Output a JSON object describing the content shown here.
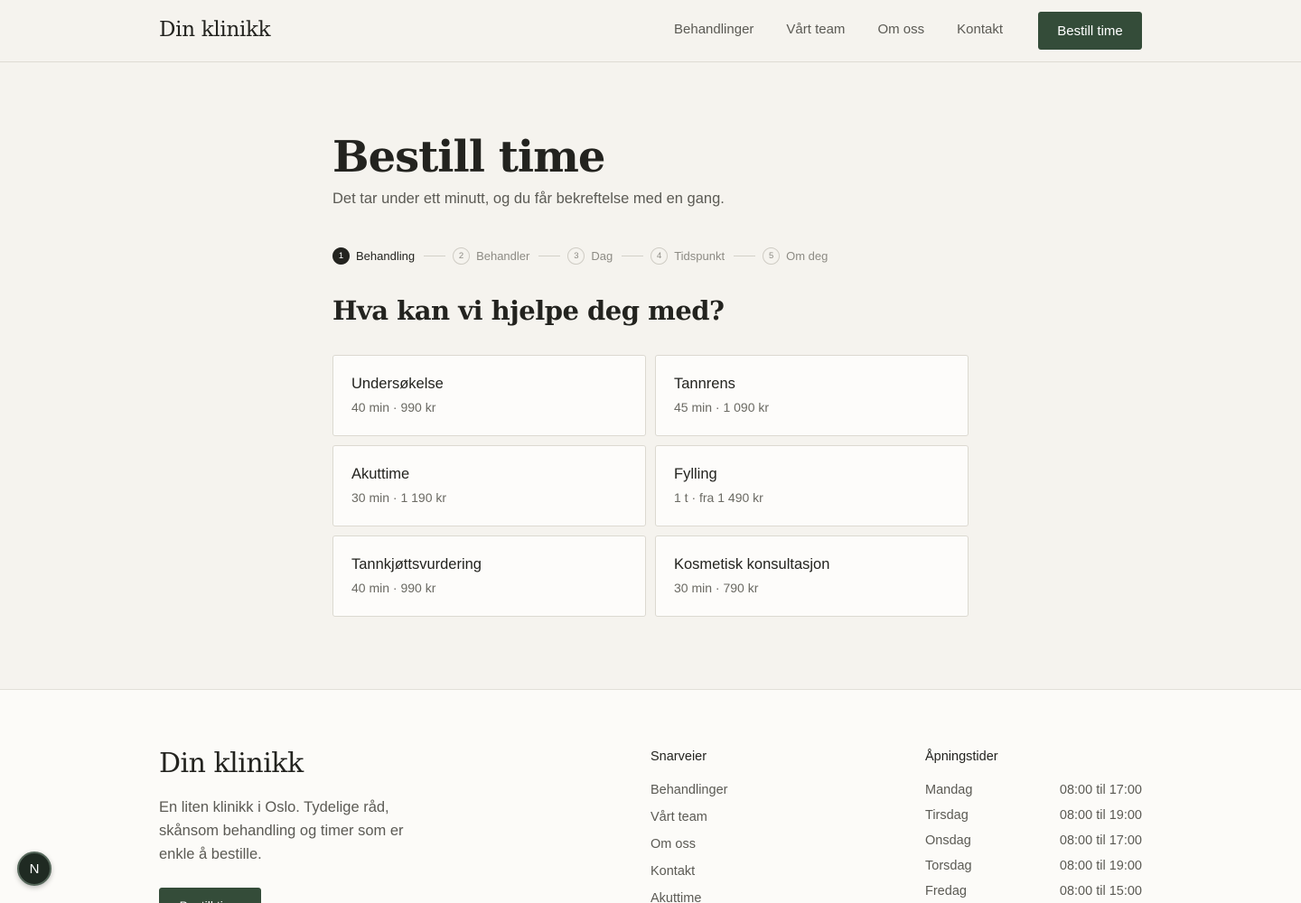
{
  "header": {
    "logo": "Din klinikk",
    "nav": [
      "Behandlinger",
      "Vårt team",
      "Om oss",
      "Kontakt"
    ],
    "cta": "Bestill time"
  },
  "main": {
    "title": "Bestill time",
    "subtitle": "Det tar under ett minutt, og du får bekreftelse med en gang.",
    "steps": [
      {
        "num": "1",
        "label": "Behandling"
      },
      {
        "num": "2",
        "label": "Behandler"
      },
      {
        "num": "3",
        "label": "Dag"
      },
      {
        "num": "4",
        "label": "Tidspunkt"
      },
      {
        "num": "5",
        "label": "Om deg"
      }
    ],
    "active_step": 1,
    "question": "Hva kan vi hjelpe deg med?",
    "treatments": [
      {
        "name": "Undersøkelse",
        "meta": "40 min · 990 kr"
      },
      {
        "name": "Tannrens",
        "meta": "45 min · 1 090 kr"
      },
      {
        "name": "Akuttime",
        "meta": "30 min · 1 190 kr"
      },
      {
        "name": "Fylling",
        "meta": "1 t · fra 1 490 kr"
      },
      {
        "name": "Tannkjøttsvurdering",
        "meta": "40 min · 990 kr"
      },
      {
        "name": "Kosmetisk konsultasjon",
        "meta": "30 min · 790 kr"
      }
    ]
  },
  "footer": {
    "logo": "Din klinikk",
    "description": "En liten klinikk i Oslo. Tydelige råd, skånsom behandling og timer som er enkle å bestille.",
    "cta": "Bestill time",
    "shortcuts_title": "Snarveier",
    "shortcuts": [
      "Behandlinger",
      "Vårt team",
      "Om oss",
      "Kontakt",
      "Akuttime"
    ],
    "hours_title": "Åpningstider",
    "hours": [
      {
        "day": "Mandag",
        "time": "08:00 til 17:00"
      },
      {
        "day": "Tirsdag",
        "time": "08:00 til 19:00"
      },
      {
        "day": "Onsdag",
        "time": "08:00 til 17:00"
      },
      {
        "day": "Torsdag",
        "time": "08:00 til 19:00"
      },
      {
        "day": "Fredag",
        "time": "08:00 til 15:00"
      }
    ]
  },
  "badge": "N",
  "colors": {
    "accent": "#344c39",
    "background": "#f5f3ee"
  }
}
